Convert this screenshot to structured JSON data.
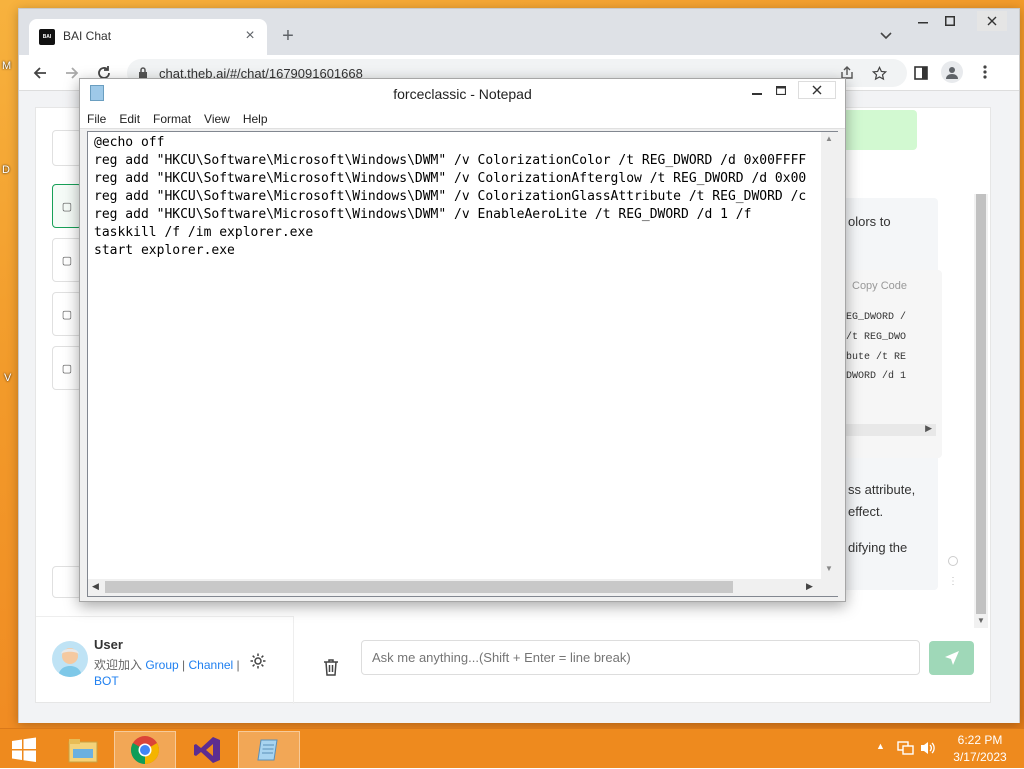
{
  "desktop": {
    "side_letters": [
      "M",
      "D",
      "V"
    ]
  },
  "browser": {
    "tab_title": "BAI Chat",
    "favicon_text": "BAI",
    "url": "chat.theb.ai/#/chat/1679091601668",
    "new_tab_icon": "+",
    "close_tab_icon": "×"
  },
  "chat": {
    "fragments": [
      "olors to",
      "ss attribute,",
      "effect.",
      "difying the"
    ],
    "code_toolbar": "Copy  Code",
    "code_lines": [
      "EG_DWORD /",
      "/t REG_DWO",
      "bute /t RE",
      "DWORD /d 1"
    ],
    "user_name": "User",
    "user_line1_prefix": "欢迎加入 ",
    "user_link_group": "Group",
    "user_link_channel": "Channel",
    "user_link_bot": "BOT",
    "input_placeholder": "Ask me anything...(Shift + Enter = line break)"
  },
  "notepad": {
    "title": "forceclassic - Notepad",
    "menu": [
      "File",
      "Edit",
      "Format",
      "View",
      "Help"
    ],
    "lines": [
      "@echo off",
      "reg add \"HKCU\\Software\\Microsoft\\Windows\\DWM\" /v ColorizationColor /t REG_DWORD /d 0x00FFFF",
      "reg add \"HKCU\\Software\\Microsoft\\Windows\\DWM\" /v ColorizationAfterglow /t REG_DWORD /d 0x00",
      "reg add \"HKCU\\Software\\Microsoft\\Windows\\DWM\" /v ColorizationGlassAttribute /t REG_DWORD /c",
      "reg add \"HKCU\\Software\\Microsoft\\Windows\\DWM\" /v EnableAeroLite /t REG_DWORD /d 1 /f",
      "taskkill /f /im explorer.exe",
      "start explorer.exe"
    ]
  },
  "taskbar": {
    "time": "6:22 PM",
    "date": "3/17/2023",
    "apps": [
      "start-button",
      "file-explorer-icon",
      "chrome-icon",
      "visual-studio-icon",
      "notepad-icon"
    ]
  },
  "colors": {
    "accent_green": "#18a058",
    "desktop_orange": "#f29a2a"
  }
}
